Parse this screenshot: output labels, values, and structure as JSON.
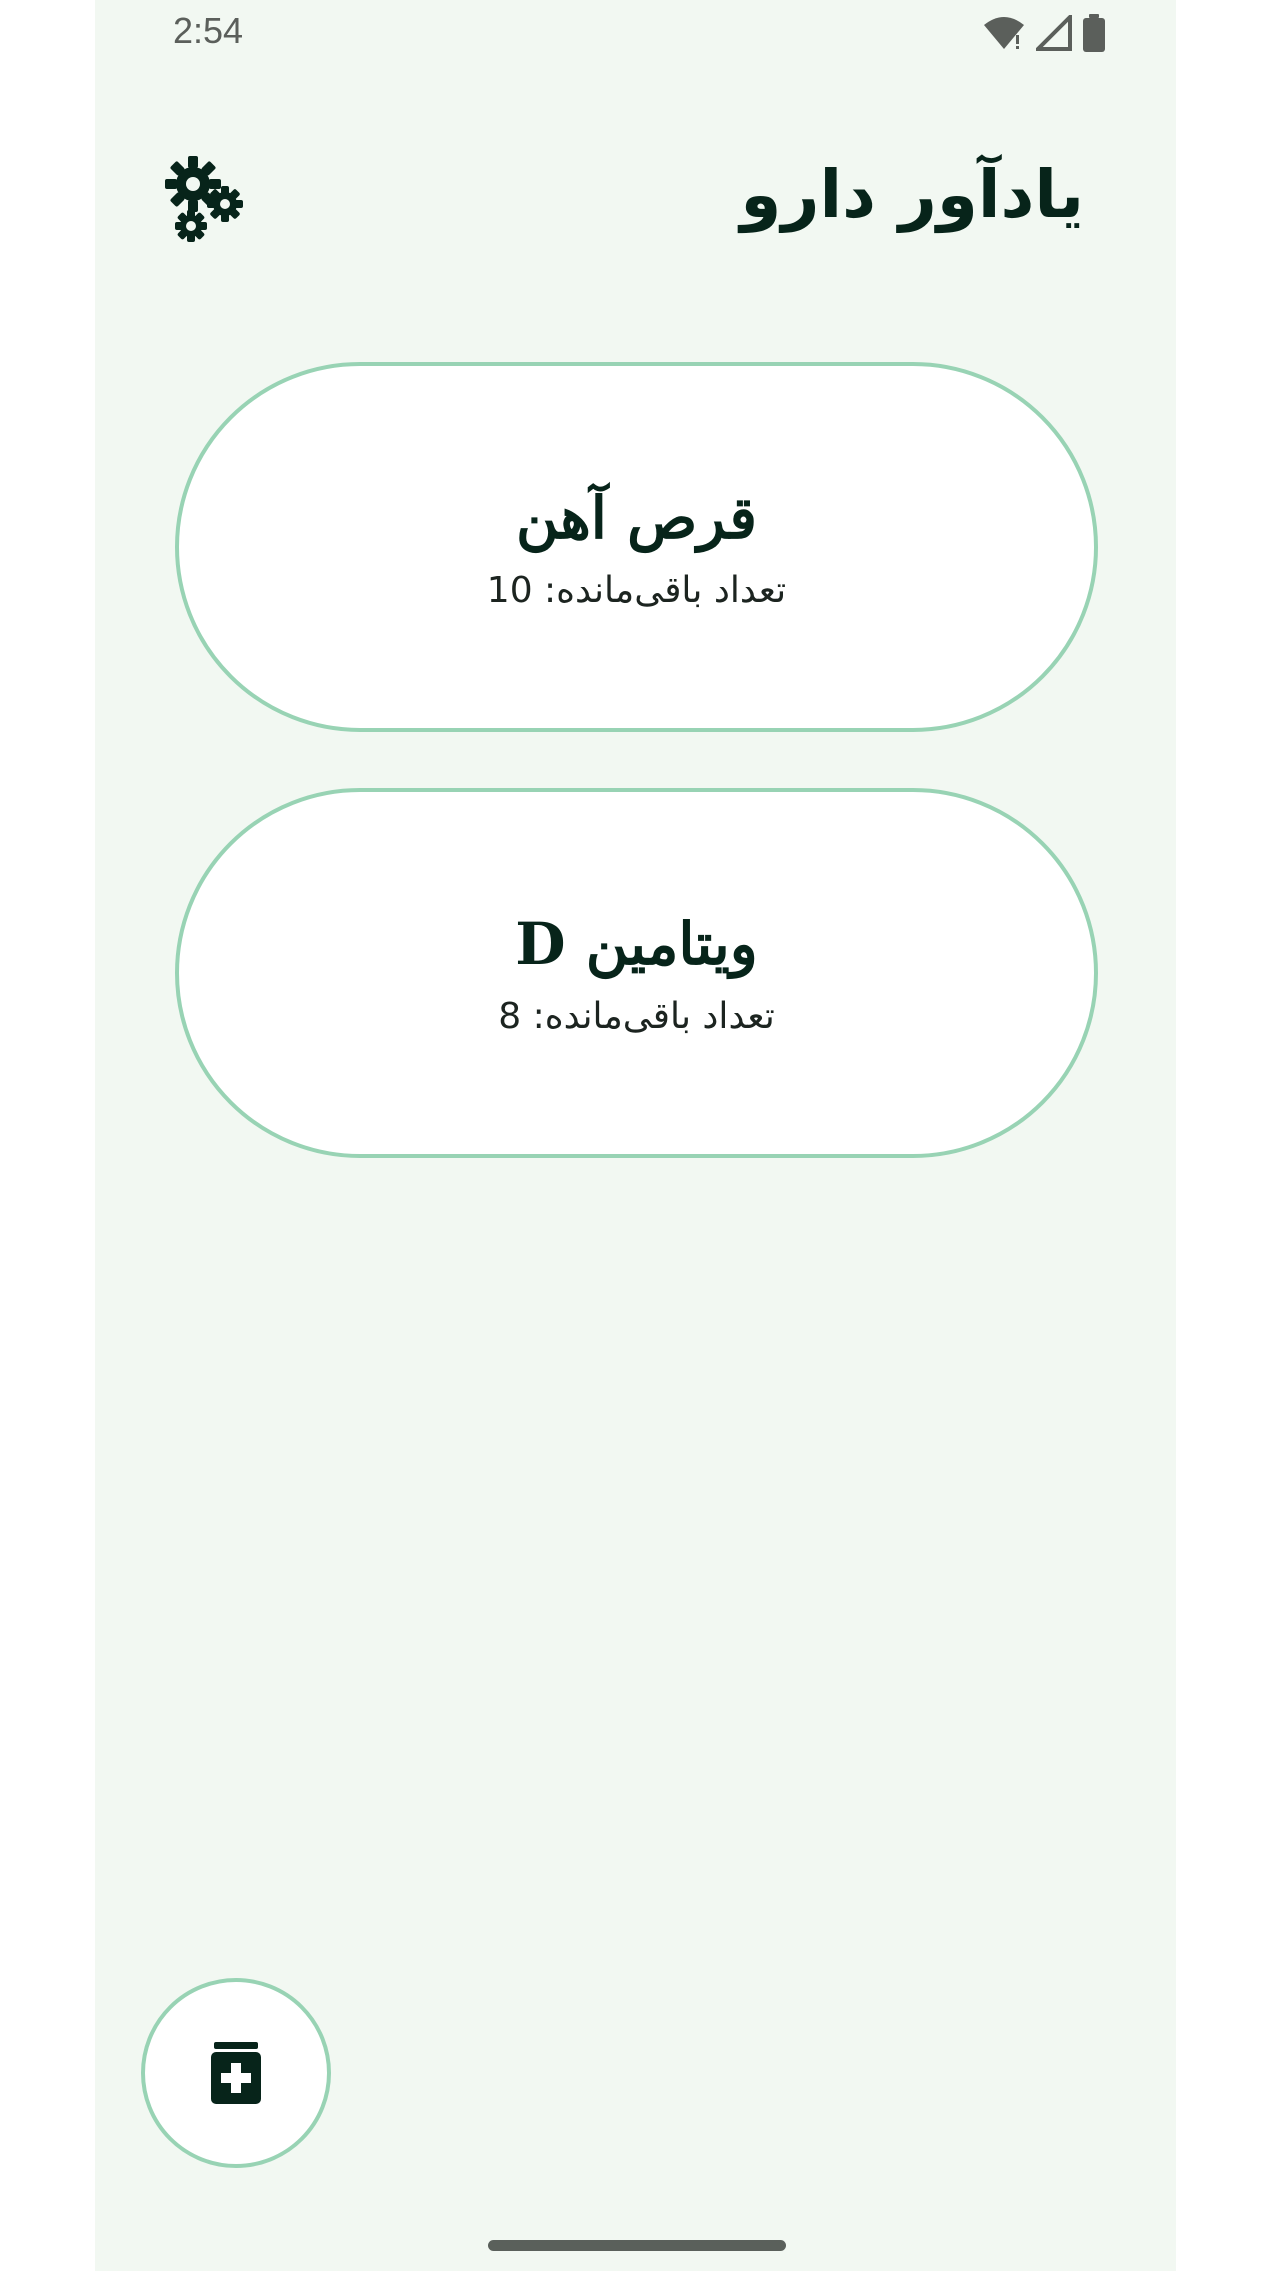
{
  "status_bar": {
    "time": "2:54",
    "icons": [
      "wifi-icon",
      "cellular-signal-icon",
      "battery-icon"
    ]
  },
  "header": {
    "title": "یادآور دارو",
    "settings_icon": "gears-icon"
  },
  "medications": [
    {
      "name": "قرص آهن",
      "remaining": "تعداد باقی‌مانده: 10"
    },
    {
      "name": "ویتامین D",
      "remaining": "تعداد باقی‌مانده: 8"
    }
  ],
  "fab": {
    "icon": "medicine-bottle-plus-icon"
  },
  "colors": {
    "background": "#f2f8f2",
    "card_border": "#98d3b4",
    "text_dark": "#07241a",
    "card_bg": "#ffffff"
  }
}
